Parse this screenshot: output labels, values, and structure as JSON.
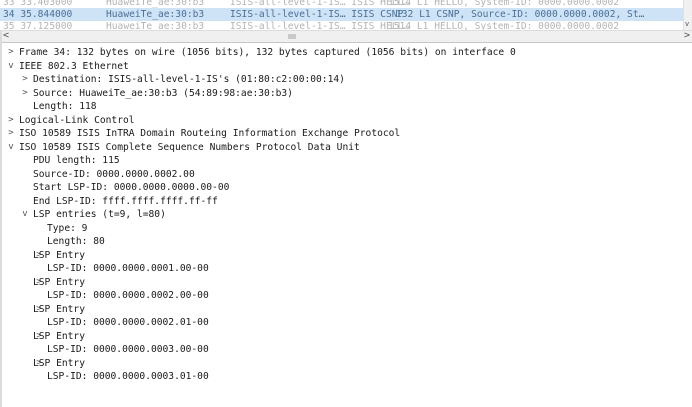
{
  "packet_list": {
    "rows": [
      {
        "no": "33 33.403000",
        "source": "HuaweiTe_ae:30:b3",
        "destination": "ISIS-all-level-1-IS… ISIS HELL…",
        "protocol": "",
        "info": "1514 L1 HELLO, System-ID: 0000.0000.0002",
        "state": "dim"
      },
      {
        "no": "34 35.844000",
        "source": "HuaweiTe_ae:30:b3",
        "destination": "ISIS-all-level-1-IS… ISIS CSNP",
        "protocol": "",
        "info": "132 L1 CSNP, Source-ID: 0000.0000.0002, St…",
        "state": "selected"
      },
      {
        "no": "35 37.125000",
        "source": "HuaweiTe_ae:30:b3",
        "destination": "ISIS-all-level-1-IS… ISIS HELL…",
        "protocol": "",
        "info": "1514 L1 HELLO, System-ID: 0000.0000.0002",
        "state": "dim"
      }
    ]
  },
  "scroll": {
    "left_arrow": "<",
    "right_arrow": ">",
    "down_arrow": "v"
  },
  "detail_tree": [
    {
      "indent": 0,
      "toggle": ">",
      "text": "Frame 34: 132 bytes on wire (1056 bits), 132 bytes captured (1056 bits) on interface 0"
    },
    {
      "indent": 0,
      "toggle": "v",
      "text": "IEEE 802.3 Ethernet"
    },
    {
      "indent": 1,
      "toggle": ">",
      "text": "Destination: ISIS-all-level-1-IS's (01:80:c2:00:00:14)"
    },
    {
      "indent": 1,
      "toggle": ">",
      "text": "Source: HuaweiTe_ae:30:b3 (54:89:98:ae:30:b3)"
    },
    {
      "indent": 2,
      "toggle": "",
      "text": "Length: 118"
    },
    {
      "indent": 0,
      "toggle": ">",
      "text": "Logical-Link Control"
    },
    {
      "indent": 0,
      "toggle": ">",
      "text": "ISO 10589 ISIS InTRA Domain Routeing Information Exchange Protocol"
    },
    {
      "indent": 0,
      "toggle": "v",
      "text": "ISO 10589 ISIS Complete Sequence Numbers Protocol Data Unit"
    },
    {
      "indent": 2,
      "toggle": "",
      "text": "PDU length: 115"
    },
    {
      "indent": 2,
      "toggle": "",
      "text": "Source-ID: 0000.0000.0002.00"
    },
    {
      "indent": 2,
      "toggle": "",
      "text": "Start LSP-ID: 0000.0000.0000.00-00"
    },
    {
      "indent": 2,
      "toggle": "",
      "text": "End LSP-ID: ffff.ffff.ffff.ff-ff"
    },
    {
      "indent": 1,
      "toggle": "v",
      "text": "LSP entries (t=9, l=80)"
    },
    {
      "indent": 3,
      "toggle": "",
      "text": "Type: 9"
    },
    {
      "indent": 3,
      "toggle": "",
      "text": "Length: 80"
    },
    {
      "indent": 2,
      "toggle": ">",
      "text": "LSP Entry"
    },
    {
      "indent": 3,
      "toggle": "",
      "text": "LSP-ID: 0000.0000.0001.00-00"
    },
    {
      "indent": 2,
      "toggle": ">",
      "text": "LSP Entry"
    },
    {
      "indent": 3,
      "toggle": "",
      "text": "LSP-ID: 0000.0000.0002.00-00"
    },
    {
      "indent": 2,
      "toggle": ">",
      "text": "LSP Entry"
    },
    {
      "indent": 3,
      "toggle": "",
      "text": "LSP-ID: 0000.0000.0002.01-00"
    },
    {
      "indent": 2,
      "toggle": ">",
      "text": "LSP Entry"
    },
    {
      "indent": 3,
      "toggle": "",
      "text": "LSP-ID: 0000.0000.0003.00-00"
    },
    {
      "indent": 2,
      "toggle": ">",
      "text": "LSP Entry"
    },
    {
      "indent": 3,
      "toggle": "",
      "text": "LSP-ID: 0000.0000.0003.01-00"
    }
  ],
  "colors": {
    "selected_row_bg": "#cfe3f7",
    "selected_row_text": "#4a6f96",
    "dim_text": "#b4b4b4"
  }
}
